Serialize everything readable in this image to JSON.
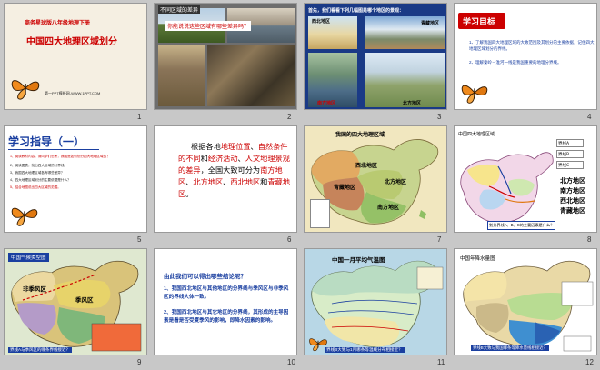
{
  "slides": [
    {
      "n": "1",
      "subtitle": "商务星球版八年级地理下册",
      "title": "中国四大地理区域划分",
      "footer": "第一PPT模板网-WWW.1PPT.COM"
    },
    {
      "n": "2",
      "header": "不同区域的差异",
      "question": "你能说说这些区域有哪些差异吗？"
    },
    {
      "n": "3",
      "prompt": "首先，我们看看下列几幅图是哪个地区的景观：",
      "captions": [
        "西北地区",
        "青藏地区",
        "南方地区",
        "北方地区"
      ]
    },
    {
      "n": "4",
      "heading": "学习目标",
      "goals": [
        "1、了解我国四大地理区域的大致范围及其划分的主要依据，记住四大地理区域划分的界线。",
        "2、理解秦岭－淮河一线是我国重要的地理分界线。"
      ]
    },
    {
      "n": "5",
      "heading": "学习指导（一）",
      "lines": [
        "1、阅读教材内容，请同学们思考，我国是如何划分四大地理区域的？",
        "2、阅读图表，找出四大区域的分界线。",
        "3、我国四大地理区域各有哪些差异？",
        "4、四大地理区域划分的主要依据是什么？",
        "5、结合地图说出四大区域的范围。"
      ]
    },
    {
      "n": "6",
      "lead": "根据各地",
      "segments": [
        "地理位置",
        "、",
        "自然条件的不同",
        "和",
        "经济活动",
        "、",
        "人文地理景观的差异",
        "，全国大致可分为",
        "南方地区",
        "、",
        "北方地区",
        "、",
        "西北地区",
        "和",
        "青藏地区",
        "。"
      ]
    },
    {
      "n": "7",
      "title": "我国的四大地理区域",
      "labels": [
        "西北地区",
        "北方地区",
        "青藏地区",
        "南方地区"
      ]
    },
    {
      "n": "8",
      "title": "中国四大地理区域",
      "legend": [
        "界线A",
        "界线B",
        "界线C"
      ],
      "regions": [
        "北方地区",
        "南方地区",
        "西北地区",
        "青藏地区"
      ],
      "question": "划分界线A、B、C的主要因素是什么？"
    },
    {
      "n": "9",
      "title": "中国气候类型图",
      "labels": [
        "季风区",
        "非季风区"
      ],
      "question": "界线A与季风区的哪条界线接近？"
    },
    {
      "n": "10",
      "heading": "由此我们可以得出哪些结论呢？",
      "points": [
        "1、我国西北地区与其他地区的分界线与季风区与非季风区的界线大体一致。",
        "2、我国西北地区与其它地区的分界线，其形成的主导因素是看是否受夏季风的影响，即降水因素的影响。"
      ]
    },
    {
      "n": "11",
      "title": "中国一月平均气温图",
      "question": "界线B大致与1月哪条等温线分布相接近？"
    },
    {
      "n": "12",
      "title": "中国年降水量图",
      "question": "界线B大致与我国哪条等降水量线相接近？"
    }
  ]
}
